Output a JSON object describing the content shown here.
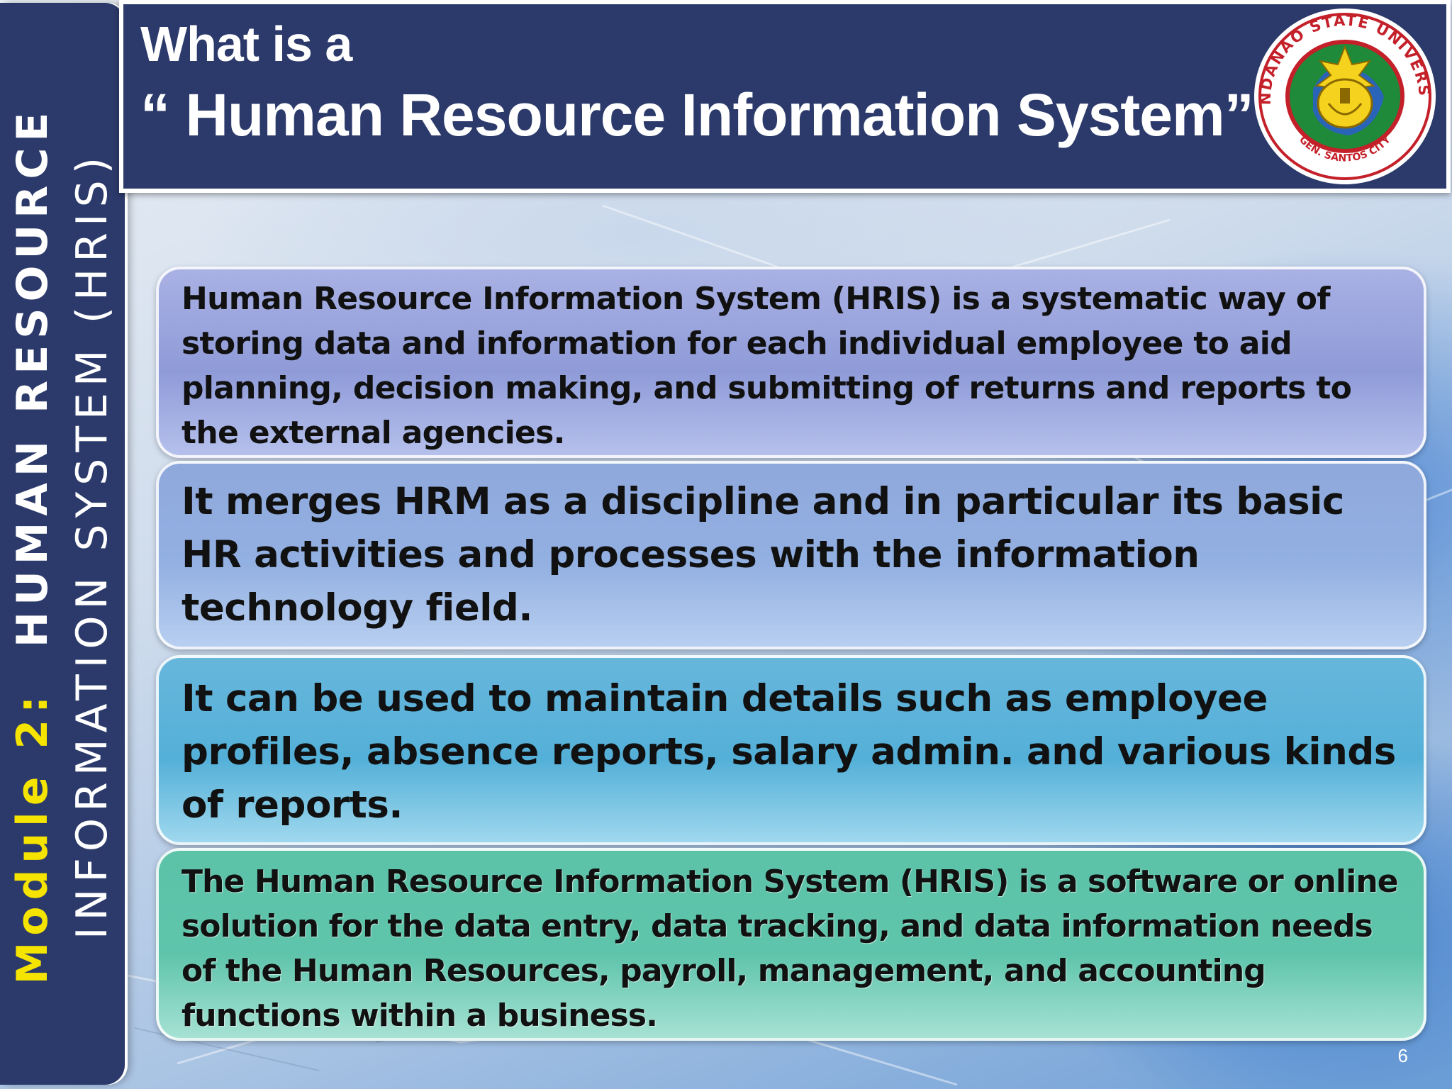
{
  "sidebar": {
    "module_label": "Module 2:",
    "line1_rest": "HUMAN RESOURCE",
    "line2": "INFORMATION SYSTEM (HRIS)"
  },
  "header": {
    "title_line1": "What is a",
    "title_line2": "“ Human Resource Information System”"
  },
  "logo": {
    "text_top": "MINDANAO STATE UNIVERSITY",
    "text_bottom": "GEN. SANTOS CITY"
  },
  "content": {
    "box1": "Human Resource Information System (HRIS) is a systematic way of storing data and information for each individual employee to aid planning, decision making, and submitting of returns and reports to the external agencies.",
    "box2": "It merges HRM as a discipline and in particular its basic HR activities and processes with the information technology field.",
    "box3": "It can be used to maintain details such as employee profiles, absence reports, salary admin. and various kinds of reports.",
    "box4": "The Human Resource Information System (HRIS) is a software or online solution for the data entry, data tracking, and data information needs of the Human Resources, payroll, management, and accounting functions within a business."
  },
  "slide_number": "6",
  "colors": {
    "navy": "#2c3a6b",
    "module_yellow": "#f5e400",
    "box1": "#9aa4dc",
    "box2": "#93b0e2",
    "box3": "#5fb3da",
    "box4": "#5ec4ab"
  }
}
